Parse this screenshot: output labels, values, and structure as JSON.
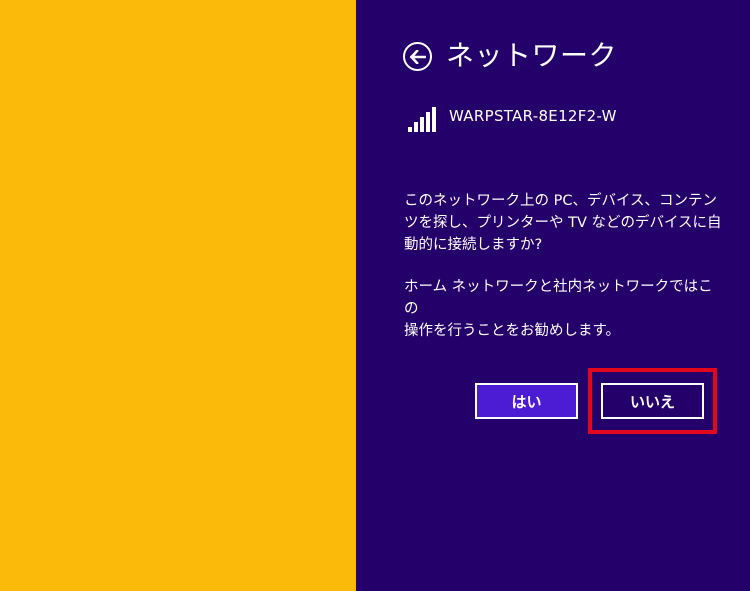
{
  "colors": {
    "background_left": "#FBBA0A",
    "panel_background": "#24006A",
    "button_primary": "#4B1CD3",
    "highlight": "#E3071B",
    "text": "#FFFFFF"
  },
  "panel": {
    "back_icon": "back-arrow-circle-icon",
    "title": "ネットワーク",
    "network": {
      "signal_icon": "wifi-signal-bars-icon",
      "signal_level": "5/5",
      "ssid": "WARPSTAR-8E12F2-W"
    },
    "message_1": "このネットワーク上の PC、デバイス、コンテン\nツを探し、プリンターや TV などのデバイスに自\n動的に接続しますか?",
    "message_2": "ホーム ネットワークと社内ネットワークではこの\n操作を行うことをお勧めします。",
    "buttons": {
      "yes": "はい",
      "no": "いいえ"
    }
  }
}
